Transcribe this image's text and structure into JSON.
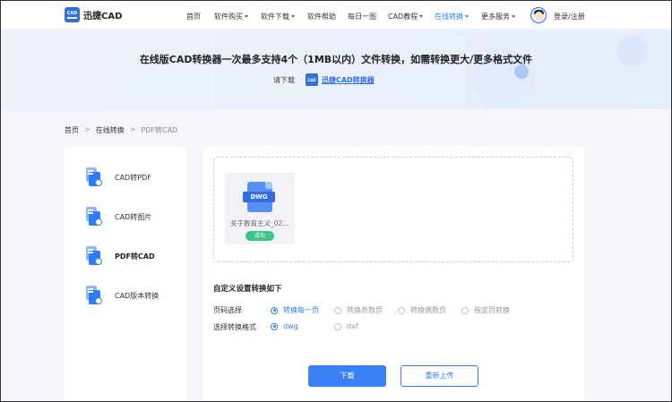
{
  "header": {
    "logo_mark": "CAD",
    "logo_text": "迅捷CAD",
    "nav": [
      {
        "label": "首页",
        "dropdown": false,
        "active": false
      },
      {
        "label": "软件购买",
        "dropdown": true,
        "active": false
      },
      {
        "label": "软件下载",
        "dropdown": true,
        "active": false
      },
      {
        "label": "软件帮助",
        "dropdown": false,
        "active": false
      },
      {
        "label": "每日一图",
        "dropdown": false,
        "active": false
      },
      {
        "label": "CAD教程",
        "dropdown": true,
        "active": false
      },
      {
        "label": "在线转换",
        "dropdown": true,
        "active": true
      },
      {
        "label": "更多服务",
        "dropdown": true,
        "active": false
      }
    ],
    "login": "登录/注册"
  },
  "banner": {
    "title": "在线版CAD转换器一次最多支持4个（1MB以内）文件转换，如需转换更大/更多格式文件",
    "prompt": "请下载",
    "logo_mark": "CAD",
    "link": "迅捷CAD转换器"
  },
  "breadcrumb": {
    "items": [
      "首页",
      "在线转换",
      "PDF转CAD"
    ],
    "separator": ">"
  },
  "sidebar": {
    "items": [
      {
        "label": "CAD转PDF",
        "active": false
      },
      {
        "label": "CAD转图片",
        "active": false
      },
      {
        "label": "PDF转CAD",
        "active": true
      },
      {
        "label": "CAD版本转换",
        "active": false
      }
    ]
  },
  "upload": {
    "file": {
      "type_label": "DWG",
      "name": "关于教育主义_02...",
      "status": "成功"
    }
  },
  "settings": {
    "title": "自定义设置转换如下",
    "page_label": "页码选择",
    "page_options": [
      {
        "label": "转换每一页",
        "checked": true
      },
      {
        "label": "转换奇数页",
        "checked": false
      },
      {
        "label": "转换偶数页",
        "checked": false
      },
      {
        "label": "指定页转换",
        "checked": false
      }
    ],
    "format_label": "选择转换格式",
    "format_options": [
      {
        "label": "dwg",
        "checked": true
      },
      {
        "label": "dxf",
        "checked": false
      }
    ]
  },
  "actions": {
    "download": "下载",
    "reupload": "重新上传"
  },
  "colors": {
    "accent": "#2f7df6",
    "brand": "#2f6fe0",
    "success": "#3cc58b",
    "banner_bg": "#eef3fb",
    "page_bg": "#f4f6f9"
  }
}
